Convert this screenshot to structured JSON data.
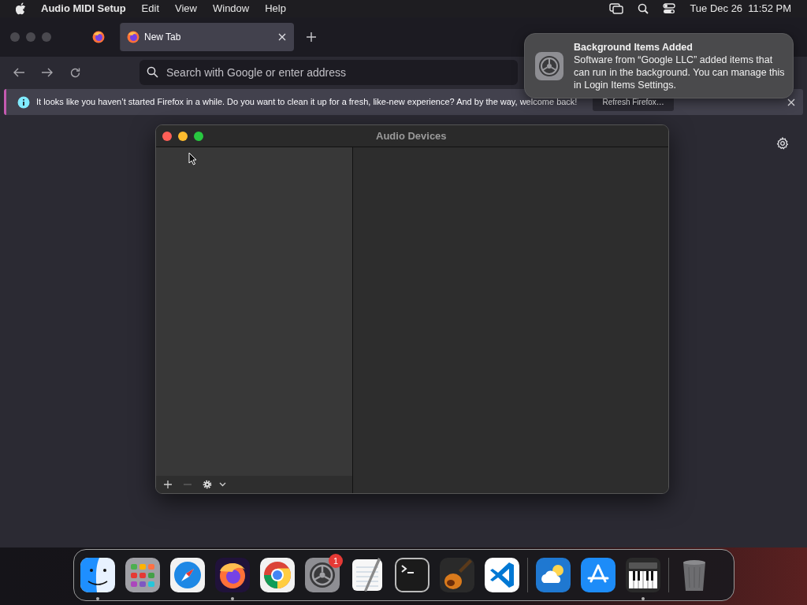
{
  "menu_bar": {
    "app_name": "Audio MIDI Setup",
    "menus": [
      "Edit",
      "View",
      "Window",
      "Help"
    ],
    "clock": "Tue Dec 26  11:52 PM"
  },
  "browser": {
    "tabs": [
      {
        "kind": "pinned",
        "selected": false
      },
      {
        "kind": "tab",
        "label": "New Tab",
        "selected": true
      }
    ],
    "address_bar": {
      "placeholder": "Search with Google or enter address"
    },
    "info_bar": {
      "message": "It looks like you haven’t started Firefox in a while. Do you want to clean it up for a fresh, like-new experience? And by the way, welcome back!",
      "button": "Refresh Firefox…"
    }
  },
  "notification": {
    "title": "Background Items Added",
    "body": "Software from “Google LLC” added items that can run in the background. You can manage this in Login Items Settings."
  },
  "audio_window": {
    "title": "Audio Devices"
  },
  "dock": {
    "apps": [
      {
        "running": true
      },
      {
        "running": false
      },
      {
        "running": false
      },
      {
        "running": true
      },
      {
        "running": false
      },
      {
        "running": false,
        "badge": "1"
      },
      {
        "running": false
      },
      {
        "running": false
      },
      {
        "running": false
      },
      {
        "running": false
      }
    ],
    "others": [
      {
        "running": false
      },
      {
        "running": false
      },
      {
        "running": true
      }
    ]
  }
}
